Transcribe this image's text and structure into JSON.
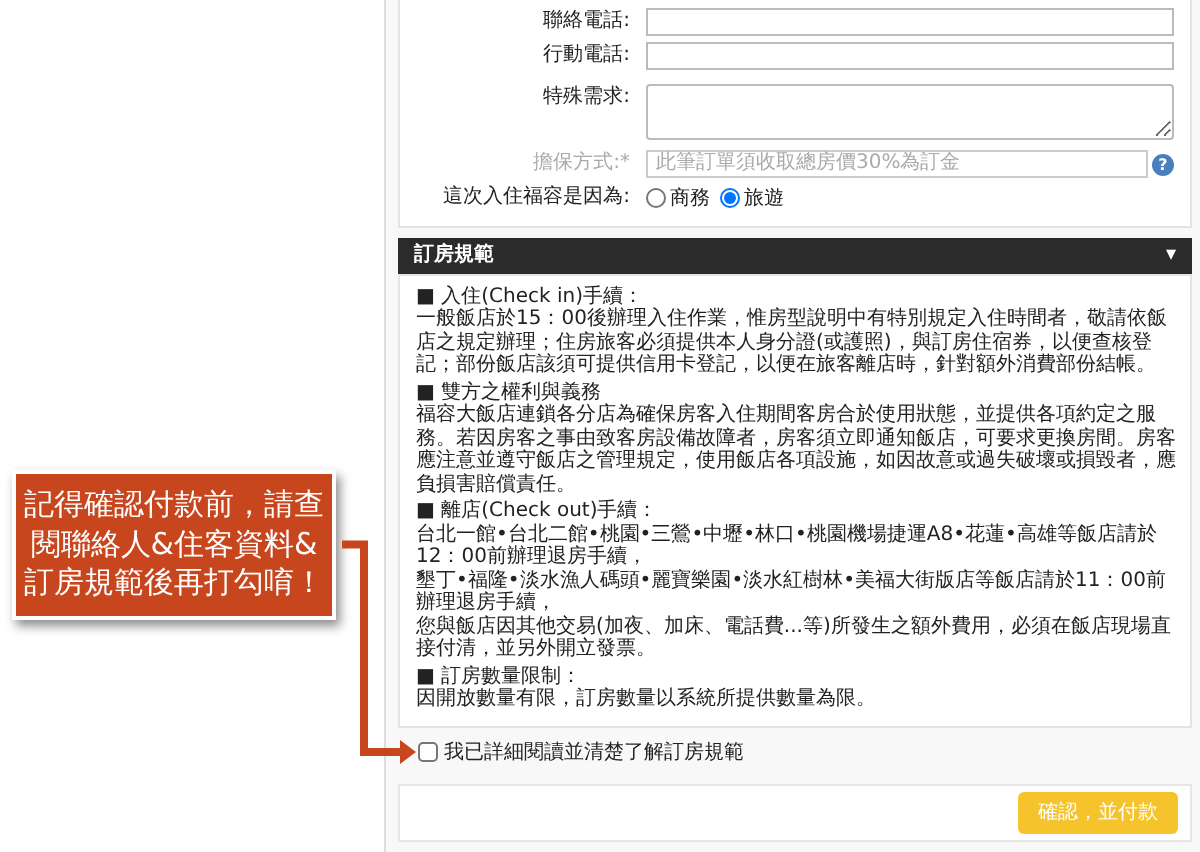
{
  "form": {
    "fields": [
      {
        "kind": "input",
        "label": "聯絡電話:"
      },
      {
        "kind": "input",
        "label": "行動電話:"
      },
      {
        "kind": "textarea",
        "label": "特殊需求:"
      },
      {
        "kind": "select",
        "label": "擔保方式:*",
        "value": "此筆訂單須收取總房價30%為訂金",
        "disabled": true,
        "help": "?"
      },
      {
        "kind": "radio",
        "label": "這次入住福容是因為:",
        "options": [
          {
            "label": "商務",
            "selected": false
          },
          {
            "label": "旅遊",
            "selected": true
          }
        ]
      }
    ]
  },
  "rules_panel": {
    "title": "訂房規範",
    "toggle": "▾",
    "sections": [
      {
        "heading": "■ 入住(Check in)手續：",
        "paragraphs": [
          "一般飯店於15：00後辦理入住作業，惟房型說明中有特別規定入住時間者，敬請依飯店之規定辦理；住房旅客必須提供本人身分證(或護照)，與訂房住宿券，以便查核登記；部份飯店該須可提供信用卡登記，以便在旅客離店時，針對額外消費部份結帳。"
        ]
      },
      {
        "heading": "■ 雙方之權利與義務",
        "paragraphs": [
          "福容大飯店連鎖各分店為確保房客入住期間客房合於使用狀態，並提供各項約定之服務。若因房客之事由致客房設備故障者，房客須立即通知飯店，可要求更換房間。房客應注意並遵守飯店之管理規定，使用飯店各項設施，如因故意或過失破壞或損毀者，應負損害賠償責任。"
        ]
      },
      {
        "heading": "■ 離店(Check out)手續：",
        "paragraphs": [
          "台北一館•台北二館•桃園•三鶯•中壢•林口•桃園機場捷運A8•花蓮•高雄等飯店請於12：00前辦理退房手續，",
          "墾丁•福隆•淡水漁人碼頭•麗寶樂園•淡水紅樹林•美福大街版店等飯店請於11：00前辦理退房手續，",
          "您與飯店因其他交易(加夜、加床、電話費...等)所發生之額外費用，必須在飯店現場直接付清，並另外開立發票。"
        ]
      },
      {
        "heading": "■ 訂房數量限制：",
        "paragraphs": [
          "因開放數量有限，訂房數量以系統所提供數量為限。"
        ]
      }
    ]
  },
  "agreement": {
    "label": "我已詳細閱讀並清楚了解訂房規範",
    "checked": false
  },
  "pay_button": "確認，並付款",
  "callout": {
    "text": "記得確認付款前，請查閱聯絡人&住客資料&訂房規範後再打勾唷！"
  }
}
